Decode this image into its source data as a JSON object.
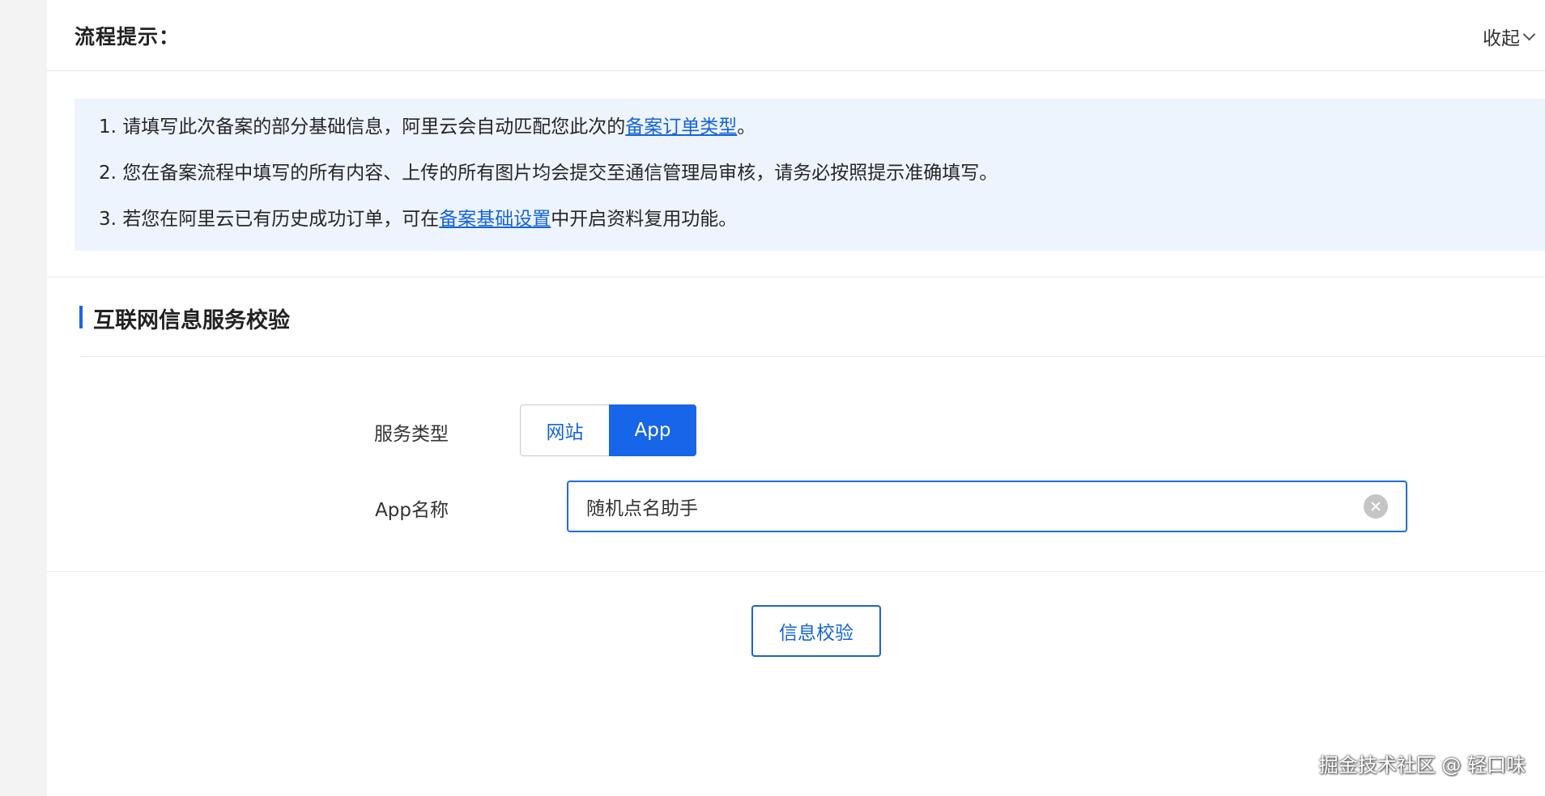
{
  "flow": {
    "title": "流程提示：",
    "collapse_label": "收起"
  },
  "tips": {
    "items": [
      {
        "before": "1. 请填写此次备案的部分基础信息，阿里云会自动匹配您此次的",
        "link": "备案订单类型",
        "after": "。"
      },
      {
        "before": "2. 您在备案流程中填写的所有内容、上传的所有图片均会提交至通信管理局审核，请务必按照提示准确填写。",
        "link": "",
        "after": ""
      },
      {
        "before": "3. 若您在阿里云已有历史成功订单，可在",
        "link": "备案基础设置",
        "after": "中开启资料复用功能。"
      }
    ]
  },
  "section": {
    "title": "互联网信息服务校验"
  },
  "form": {
    "service_type_label": "服务类型",
    "service_options": [
      "网站",
      "App"
    ],
    "selected_service": "App",
    "app_name_label": "App名称",
    "app_name_value": "随机点名助手"
  },
  "actions": {
    "verify_label": "信息校验"
  },
  "watermark": {
    "text": "掘金技术社区 @ 轻口味"
  },
  "colors": {
    "accent": "#1765e8",
    "link": "#1463d9",
    "tips_bg": "#eef4fd"
  }
}
